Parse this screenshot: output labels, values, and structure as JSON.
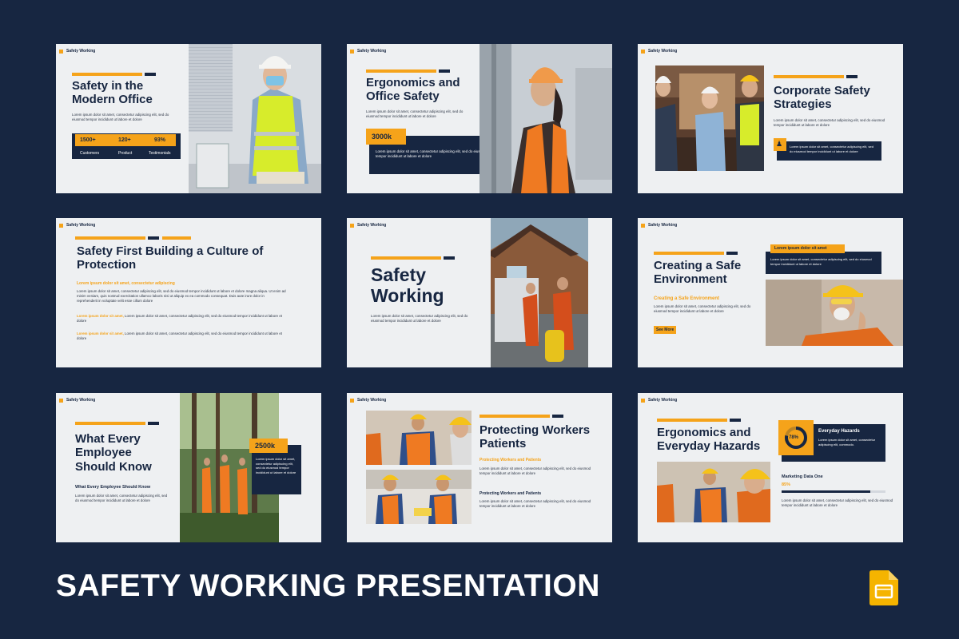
{
  "brand": "Safety Working",
  "lorem_short": "Lorem ipsum dolor sit amet, consectetur adipiscing elit, sed do eiusmod tempor incididunt ut labore et dolore",
  "lorem_long": "Lorem ipsum dolor sit amet, consectetur adipiscing elit, sed do eiusmod tempor incididunt ut labore et dolore magna aliqua. Ut enim ad minim veniam, quis nostrud exercitation ullamco laboris nisi ut aliquip ex ea commodo consequat. Duis aute irure dolor in reprehenderit in voluptate velit esse cillum dolore",
  "slides": {
    "s1": {
      "title": "Safety in the Modern Office",
      "stats": [
        {
          "value": "1500+",
          "label": "Customers"
        },
        {
          "value": "120+",
          "label": "Product"
        },
        {
          "value": "93%",
          "label": "Testimonials"
        }
      ]
    },
    "s2": {
      "title": "Ergonomics and Office Safety",
      "badge": "3000k"
    },
    "s3": {
      "title": "Corporate Safety Strategies"
    },
    "s4": {
      "title": "Safety First Building a Culture of Protection",
      "subtitle": "Lorem ipsum dolor sit amet, consectetur adipiscing",
      "p2_lead": "Lorem ipsum dolor sit amet,",
      "p3_lead": "Lorem ipsum dolor sit amet,"
    },
    "s5": {
      "title": "Safety Working"
    },
    "s6": {
      "title": "Creating a Safe Environment",
      "tag": "Lorem ipsum dolor sit amet",
      "subtitle": "Creating a Safe Environment",
      "button": "See More"
    },
    "s7": {
      "title": "What Every Employee Should Know",
      "subtitle": "What Every Employee Should Know",
      "badge": "2500k"
    },
    "s8": {
      "title": "Protecting Workers Patients",
      "subtitle": "Protecting Workers and Patients",
      "subtitle2": "Protecting Workers and Patients"
    },
    "s9": {
      "title": "Ergonomics and Everyday Hazards",
      "gauge": "78%",
      "box_title": "Everyday Hazards",
      "box_text": "Lorem ipsum dolor sit amet, consectetur adipiscing elit, commodo.",
      "data_label": "Marketing Data One",
      "data_value": "85%",
      "progress": 0.85
    }
  },
  "footer": {
    "title": "SAFETY WORKING PRESENTATION"
  },
  "colors": {
    "navy": "#172641",
    "orange": "#f5a31a",
    "slide_bg": "#eef0f2"
  },
  "icons": {
    "app": "google-slides-icon",
    "people": "people-icon"
  }
}
